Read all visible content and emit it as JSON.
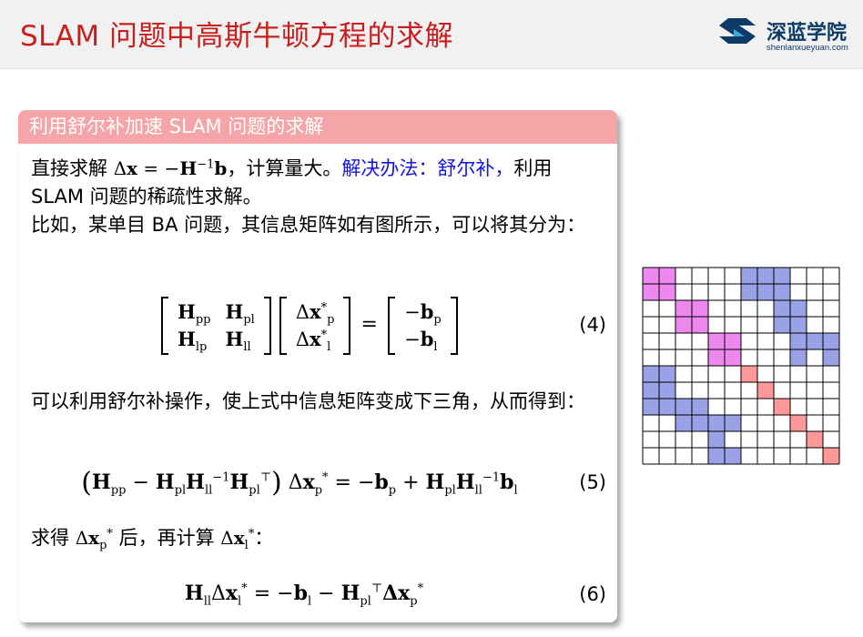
{
  "header": {
    "title": "SLAM 问题中高斯牛顿方程的求解"
  },
  "logo": {
    "name": "深蓝学院",
    "url": "shenlanxueyuan.com"
  },
  "block": {
    "title": "利用舒尔补加速 SLAM 问题的求解",
    "p1_lead": "直接求解 ",
    "p1_mid": "，计算量大。",
    "p1_blue": "解决办法：舒尔补，",
    "p1_tail": "利用 SLAM 问题的稀疏性求解。",
    "p2": "比如，某单目 BA 问题，其信息矩阵如有图所示，可以将其分为：",
    "eq4_num": "(4)",
    "p3": "可以利用舒尔补操作，使上式中信息矩阵变成下三角，从而得到：",
    "eq5_num": "(5)",
    "p4_lead": "求得 ",
    "p4_mid": " 后，再计算 ",
    "p4_tail": "：",
    "eq6_num": "(6)"
  },
  "colors": {
    "title_red": "#c81e1e",
    "block_header": "#f5a5a7",
    "blue_text": "#1515dd",
    "pose_block": "#ee88ee",
    "landmark_block": "#ff9999",
    "offdiag_block": "#9aa2e6"
  },
  "matrix_figure": {
    "cells": 12,
    "pose_diagonal": [
      [
        0,
        0,
        2
      ],
      [
        2,
        2,
        2
      ],
      [
        4,
        4,
        2
      ]
    ],
    "landmark_diagonal": [
      6,
      7,
      8,
      9,
      10,
      11
    ],
    "offdiag": [
      [
        0,
        6
      ],
      [
        0,
        7
      ],
      [
        0,
        8
      ],
      [
        1,
        6
      ],
      [
        1,
        7
      ],
      [
        1,
        8
      ],
      [
        2,
        8
      ],
      [
        2,
        9
      ],
      [
        3,
        8
      ],
      [
        3,
        9
      ],
      [
        4,
        9
      ],
      [
        4,
        10
      ],
      [
        4,
        11
      ],
      [
        5,
        9
      ],
      [
        5,
        11
      ]
    ]
  }
}
